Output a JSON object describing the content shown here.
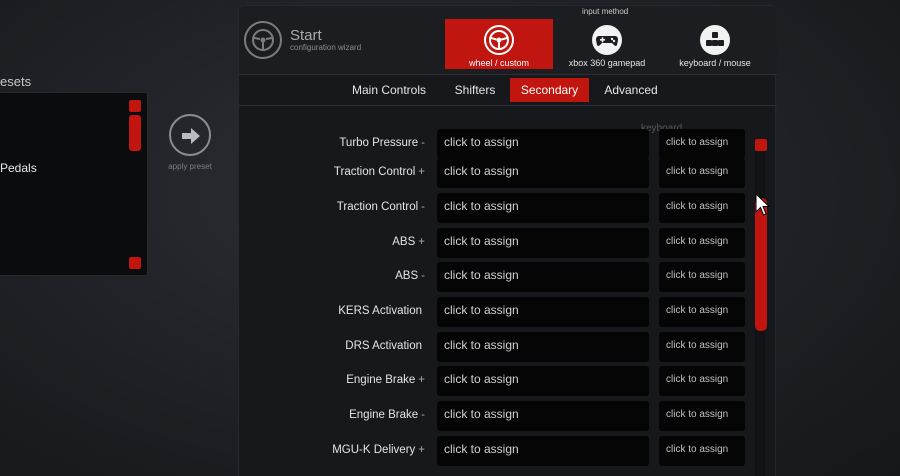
{
  "presets": {
    "title": "esets",
    "items": [
      "Pedals"
    ],
    "apply_label": "apply preset"
  },
  "header": {
    "title": "Start",
    "subtitle": "configuration wizard",
    "input_method_label": "input method",
    "input_methods": [
      {
        "label": "wheel / custom",
        "icon": "steering-wheel-icon",
        "selected": true
      },
      {
        "label": "xbox 360 gamepad",
        "icon": "gamepad-icon",
        "selected": false
      },
      {
        "label": "keyboard / mouse",
        "icon": "keyboard-icon",
        "selected": false
      }
    ]
  },
  "tabs": [
    {
      "label": "Main Controls",
      "active": false
    },
    {
      "label": "Shifters",
      "active": false
    },
    {
      "label": "Secondary",
      "active": true
    },
    {
      "label": "Advanced",
      "active": false
    }
  ],
  "columns": {
    "keyboard_label": "keyboard"
  },
  "rows": [
    {
      "name": "Turbo Pressure",
      "sign": "-",
      "main": "click to assign",
      "keyboard": "click to assign"
    },
    {
      "name": "Traction Control",
      "sign": "+",
      "main": "click to assign",
      "keyboard": "click to assign"
    },
    {
      "name": "Traction Control",
      "sign": "-",
      "main": "click to assign",
      "keyboard": "click to assign"
    },
    {
      "name": "ABS",
      "sign": "+",
      "main": "click to assign",
      "keyboard": "click to assign"
    },
    {
      "name": "ABS",
      "sign": "-",
      "main": "click to assign",
      "keyboard": "click to assign"
    },
    {
      "name": "KERS Activation",
      "sign": "",
      "main": "click to assign",
      "keyboard": "click to assign"
    },
    {
      "name": "DRS Activation",
      "sign": "",
      "main": "click to assign",
      "keyboard": "click to assign"
    },
    {
      "name": "Engine Brake",
      "sign": "+",
      "main": "click to assign",
      "keyboard": "click to assign"
    },
    {
      "name": "Engine Brake",
      "sign": "-",
      "main": "click to assign",
      "keyboard": "click to assign"
    },
    {
      "name": "MGU-K Delivery",
      "sign": "+",
      "main": "click to assign",
      "keyboard": "click to assign"
    }
  ],
  "colors": {
    "accent": "#c0160f",
    "background": "#1c1f23",
    "field": "#050505"
  }
}
